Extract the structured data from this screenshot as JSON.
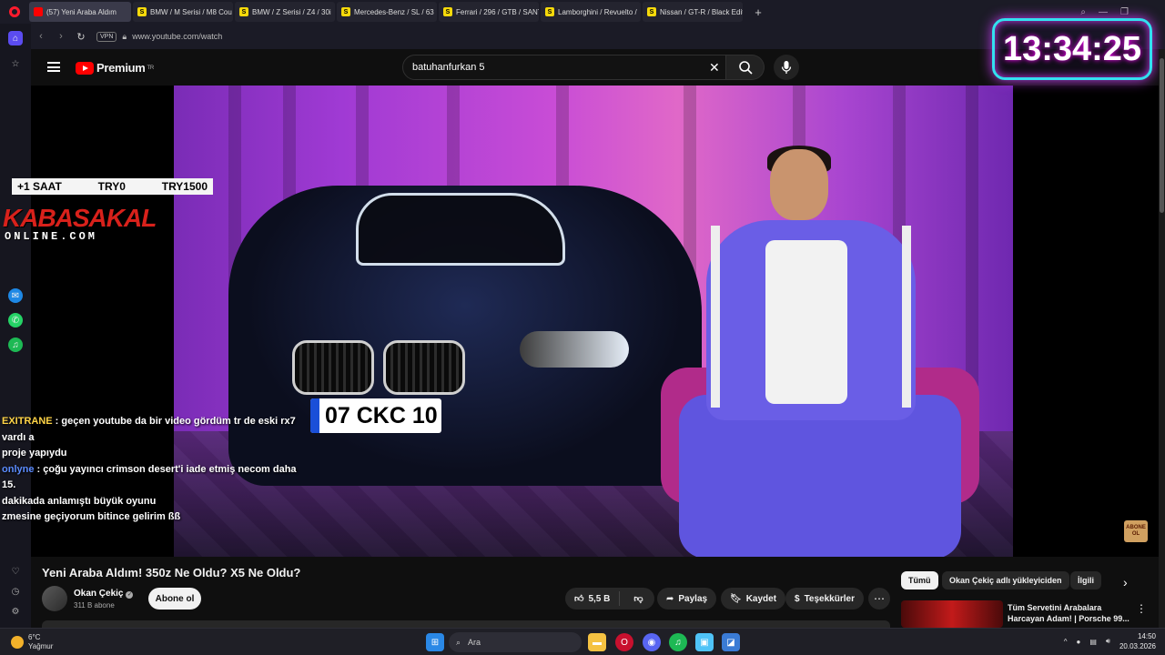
{
  "browser": {
    "tabs": [
      {
        "label": "(57) Yeni Araba Aldım",
        "favicon": "yt",
        "active": true
      },
      {
        "label": "BMW / M Serisi / M8 Cou",
        "favicon": "s"
      },
      {
        "label": "BMW / Z Serisi / Z4 / 30i",
        "favicon": "s"
      },
      {
        "label": "Mercedes-Benz / SL / 63",
        "favicon": "s"
      },
      {
        "label": "Ferrari / 296 / GTB / SANT",
        "favicon": "s"
      },
      {
        "label": "Lamborghini / Revuelto /",
        "favicon": "s"
      },
      {
        "label": "Nissan / GT-R / Black Editi",
        "favicon": "s"
      }
    ],
    "new_tab": "+",
    "url": "www.youtube.com/watch",
    "vpn": "VPN"
  },
  "youtube": {
    "logo_text": "Premium",
    "region": "TR",
    "search_value": "batuhanfurkan 5",
    "search_clear": "✕"
  },
  "video_overlay": {
    "badge": {
      "a": "+1 SAAT",
      "b": "TRY0",
      "c": "TRY1500"
    },
    "brand": "KABASAKAL",
    "brand_sub": "ONLINE.COM",
    "plate": "07 CKC 10",
    "plate_country": "TR",
    "clock": "13:34:25",
    "corner_logo": "ABONE OL",
    "chat": [
      {
        "user": "EXITRANE",
        "text": " : geçen youtube da bir video gördüm tr de eski rx7 vardı a",
        "cont": "proje yapıydu"
      },
      {
        "user": "onlyne",
        "text": " : çoğu yayıncı crimson desert'i iade etmiş necom daha 15.",
        "cont": "dakikada anlamıştı büyük oyunu"
      },
      {
        "user": "",
        "text": "zmesine geçiyorum bitince gelirim ßß",
        "cont": ""
      }
    ]
  },
  "video": {
    "title": "Yeni Araba Aldım! 350z Ne Oldu? X5 Ne Oldu?",
    "channel_name": "Okan Çekiç",
    "subscribers": "311 B abone",
    "subscribe_label": "Abone ol",
    "likes": "5,5 B",
    "share_label": "Paylaş",
    "save_label": "Kaydet",
    "thanks_label": "Teşekkürler",
    "more": "⋯"
  },
  "recommendations": {
    "chips": [
      "Tümü",
      "Okan Çekiç adlı yükleyiciden",
      "İlgili"
    ],
    "first_title": "Tüm Servetini Arabalara Harcayan Adam! | Porsche 99..."
  },
  "taskbar": {
    "temp": "6°C",
    "weather": "Yağmur",
    "search_placeholder": "Ara",
    "time": "14:50",
    "date": "20.03.2026"
  },
  "colors": {
    "youtube_red": "#ff0000",
    "clock_border": "#33e0f0",
    "brand_red": "#d8211b"
  }
}
